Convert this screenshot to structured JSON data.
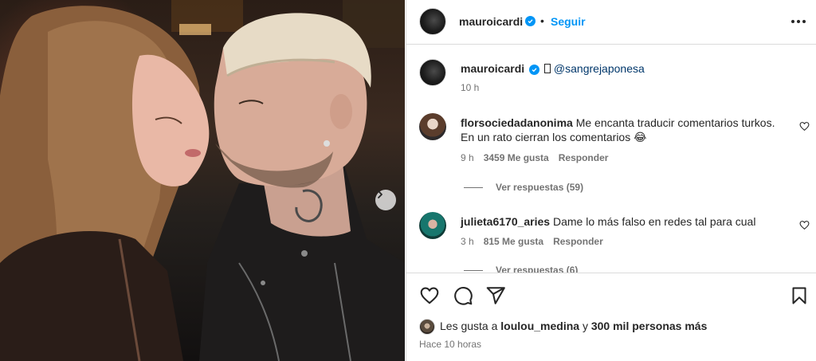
{
  "post": {
    "author": "mauroicardi",
    "follow_label": "Seguir",
    "separator": "•",
    "caption": {
      "username": "mauroicardi",
      "mention": "@sangrejaponesa",
      "time": "10 h"
    }
  },
  "comments": [
    {
      "username": "florsociedadanonima",
      "text": "Me encanta traducir comentarios turkos. En un rato cierran los comentarios 😂",
      "time": "9 h",
      "likes": "3459 Me gusta",
      "reply_label": "Responder",
      "view_replies": "Ver respuestas (59)"
    },
    {
      "username": "julieta6170_aries",
      "text": "Dame lo más falso en redes tal para cual",
      "time": "3 h",
      "likes": "815 Me gusta",
      "reply_label": "Responder",
      "view_replies": "Ver respuestas (6)"
    }
  ],
  "footer": {
    "likes_prefix": "Les gusta a",
    "likes_user": "loulou_medina",
    "likes_mid": "y",
    "likes_count": "300 mil personas más",
    "posted": "Hace 10 horas"
  },
  "colors": {
    "link": "#0095f6",
    "text": "#262626",
    "muted": "#737373",
    "border": "#dbdbdb"
  },
  "icons": [
    "verified-badge-icon",
    "more-options-icon",
    "heart-icon",
    "comment-icon",
    "share-icon",
    "bookmark-icon",
    "chevron-right-icon"
  ]
}
